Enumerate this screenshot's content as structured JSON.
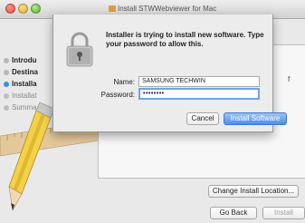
{
  "window": {
    "title": "Install STWWebviewer for Mac"
  },
  "sidebar": {
    "steps": [
      {
        "label": "Introdu",
        "state": "done"
      },
      {
        "label": "Destina",
        "state": "done"
      },
      {
        "label": "Installa",
        "state": "current"
      },
      {
        "label": "Installat",
        "state": "pending"
      },
      {
        "label": "Summa",
        "state": "pending"
      }
    ]
  },
  "pane": {
    "trailing_text": "f"
  },
  "buttons": {
    "change_location": "Change Install Location...",
    "go_back": "Go Back",
    "install": "Install"
  },
  "auth_sheet": {
    "message": "Installer is trying to install new software. Type your password to allow this.",
    "name_label": "Name:",
    "name_value": "SAMSUNG TECHWIN",
    "password_label": "Password:",
    "password_value": "••••••••",
    "cancel": "Cancel",
    "install_software": "Install Software"
  },
  "colors": {
    "accent": "#3b8fe6",
    "default_button": "#4f8ee3"
  }
}
